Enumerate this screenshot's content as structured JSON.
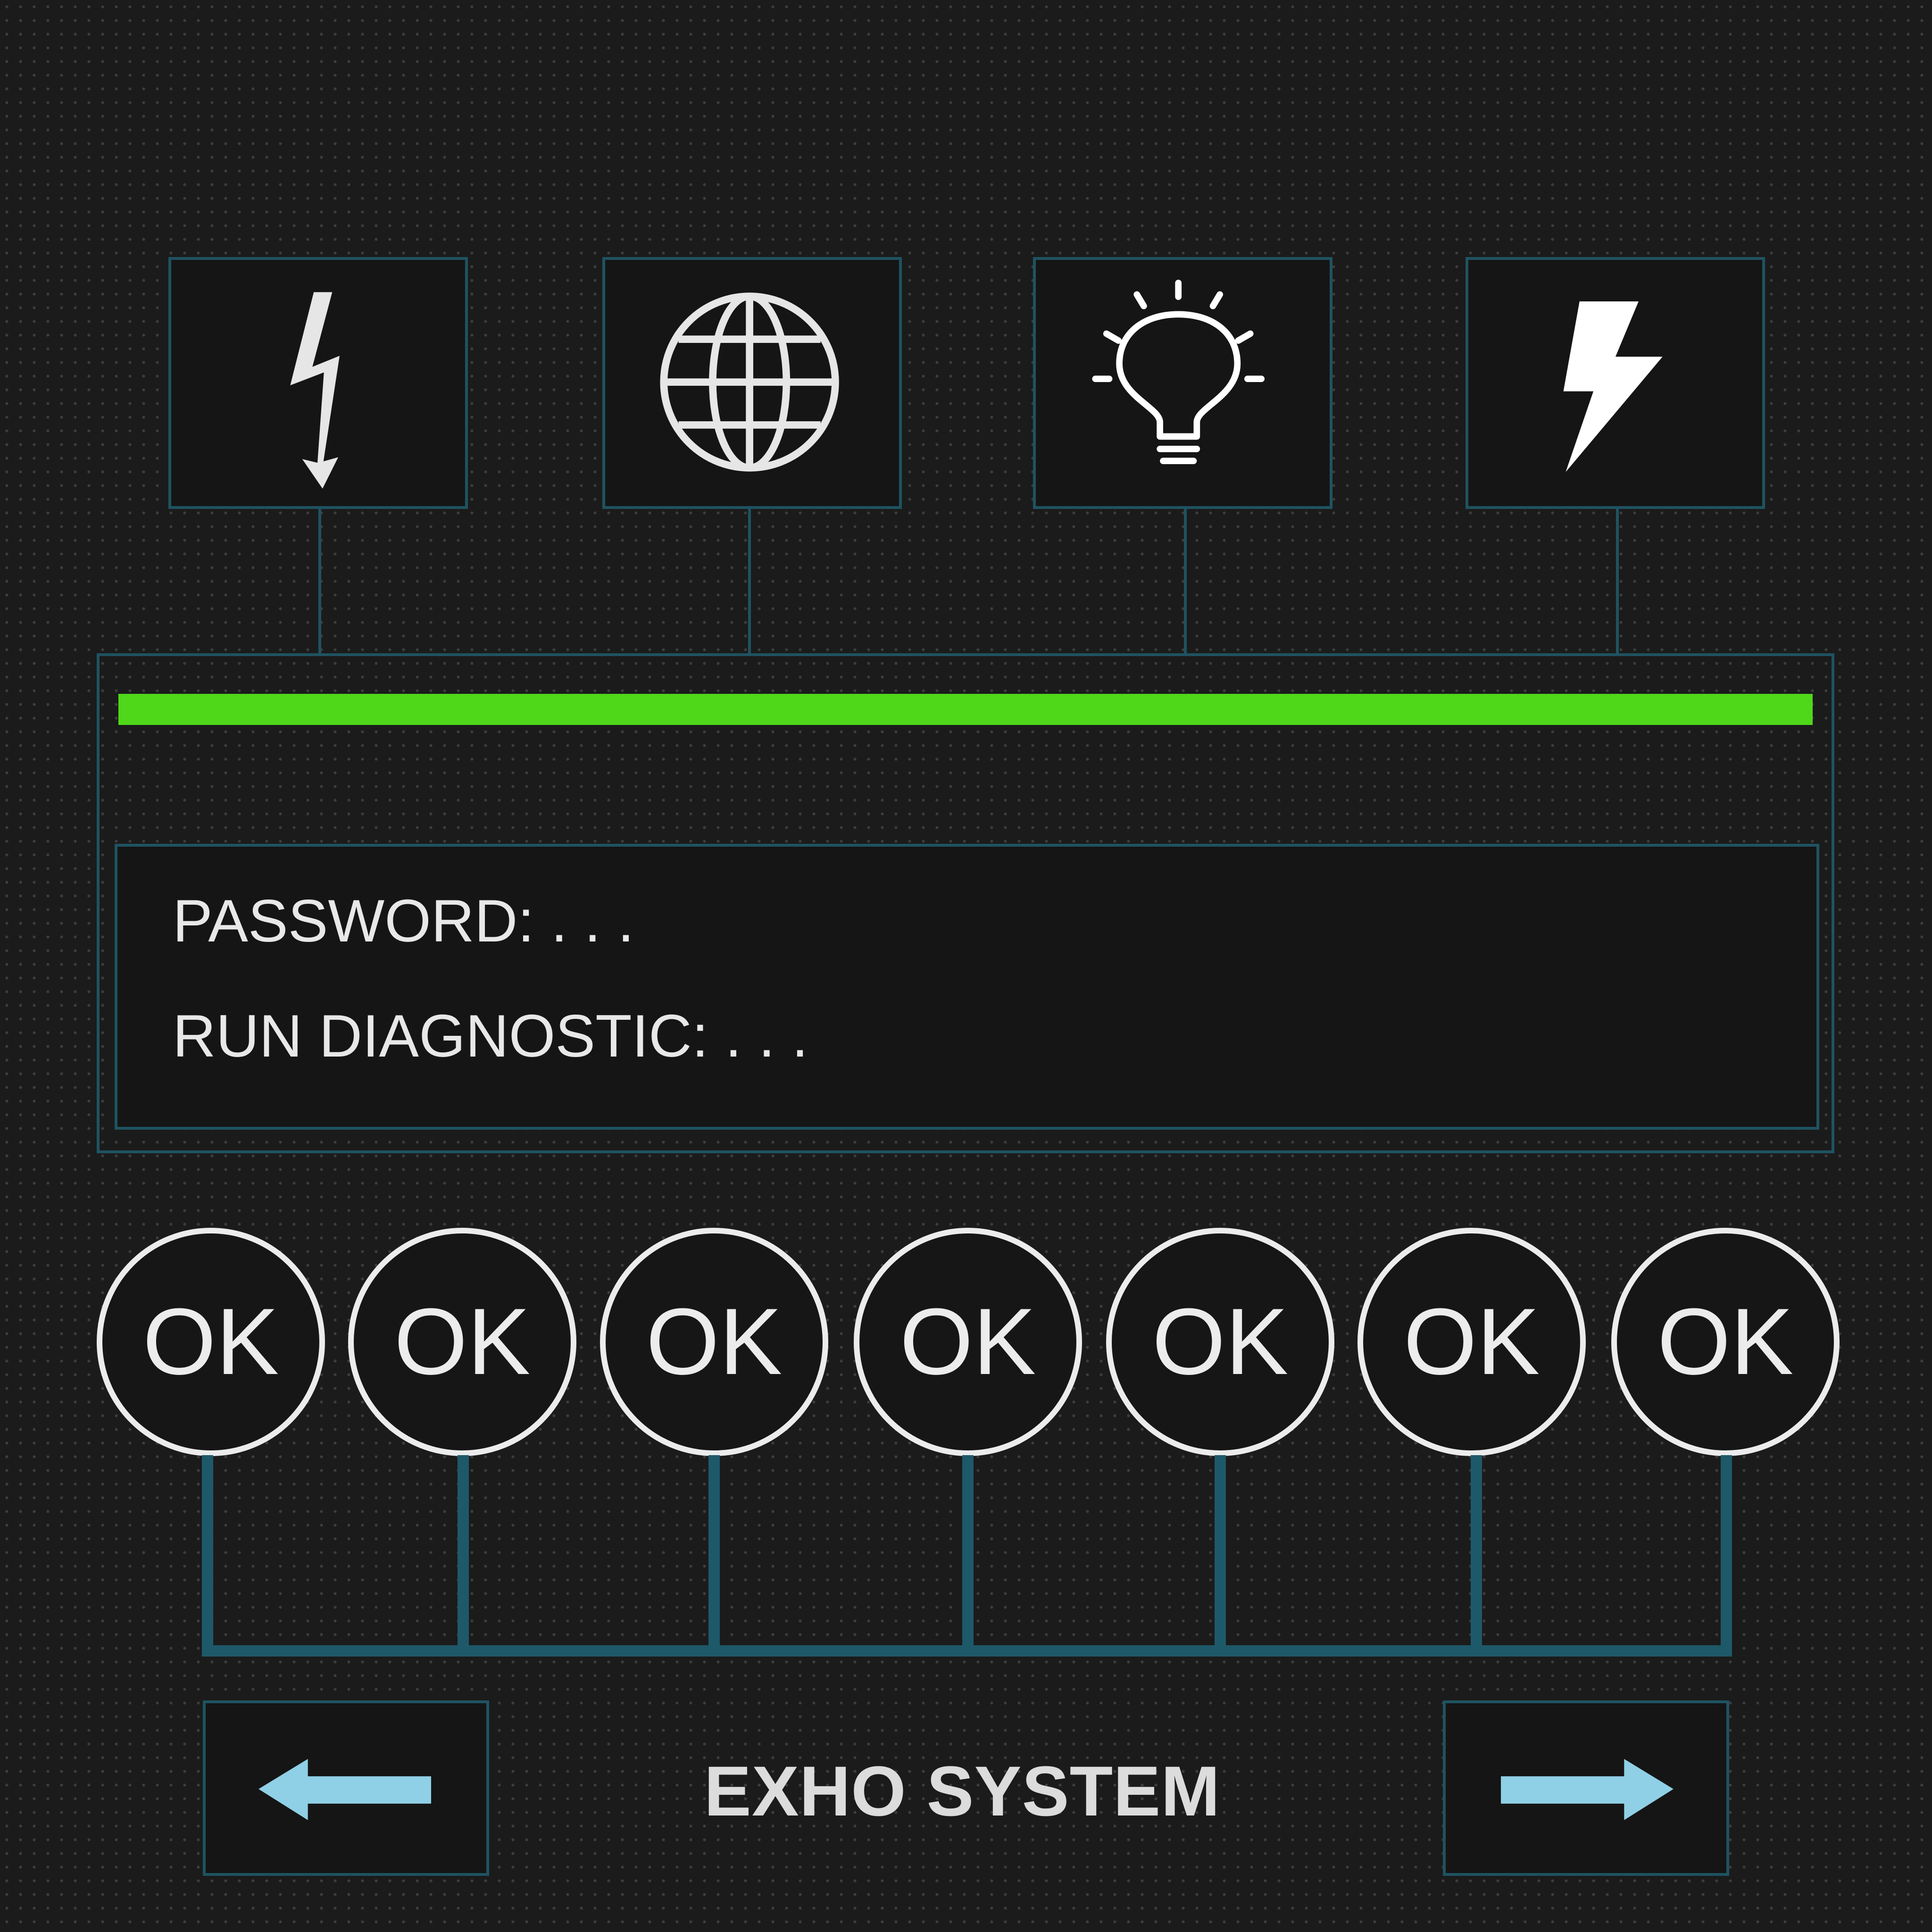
{
  "top_icons": [
    {
      "name": "high-voltage-icon",
      "color": "#e6e6e6"
    },
    {
      "name": "globe-icon",
      "color": "#e6e6e6"
    },
    {
      "name": "lightbulb-icon",
      "color": "#ffffff"
    },
    {
      "name": "lightning-bolt-icon",
      "color": "#ffffff"
    }
  ],
  "progress": {
    "value": 1.0,
    "color": "#4fd71a"
  },
  "terminal": {
    "password_label": "PASSWORD: . . .",
    "diagnostic_label": "RUN DIAGNOSTIC: . . ."
  },
  "status_buttons": [
    {
      "label": "OK"
    },
    {
      "label": "OK"
    },
    {
      "label": "OK"
    },
    {
      "label": "OK"
    },
    {
      "label": "OK"
    },
    {
      "label": "OK"
    },
    {
      "label": "OK"
    }
  ],
  "footer": {
    "title": "EXHO SYSTEM",
    "prev_icon": "arrow-left-icon",
    "next_icon": "arrow-right-icon"
  },
  "colors": {
    "background": "#1b1b1b",
    "panel": "#151515",
    "border": "#1f5361",
    "accent_green": "#4fd71a",
    "arrow": "#8fd0e6",
    "text": "#e8e8e8"
  }
}
